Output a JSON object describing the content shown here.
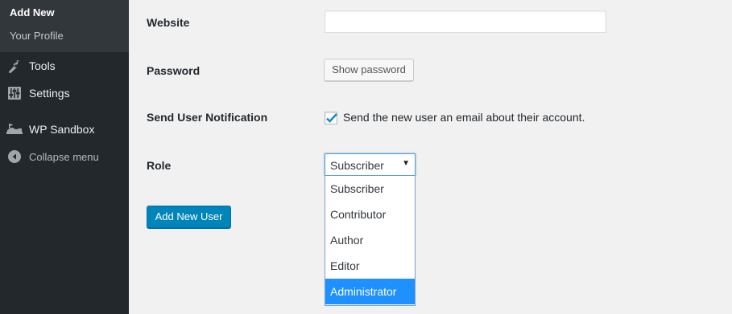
{
  "sidebar": {
    "submenu": [
      {
        "label": "Add New",
        "current": true
      },
      {
        "label": "Your Profile"
      }
    ],
    "menu": [
      {
        "label": "Tools",
        "icon": "wrench-icon"
      },
      {
        "label": "Settings",
        "icon": "sliders-icon"
      },
      {
        "label": "WP Sandbox",
        "icon": "sandbox-icon"
      },
      {
        "label": "Collapse menu",
        "icon": "collapse-arrow-icon"
      }
    ]
  },
  "form": {
    "website": {
      "label": "Website",
      "value": ""
    },
    "password": {
      "label": "Password",
      "button_label": "Show password"
    },
    "notification": {
      "label": "Send User Notification",
      "checkbox_label": "Send the new user an email about their account.",
      "checked": true
    },
    "role": {
      "label": "Role",
      "selected": "Subscriber",
      "options": [
        "Subscriber",
        "Contributor",
        "Author",
        "Editor",
        "Administrator"
      ],
      "highlighted": "Administrator"
    },
    "submit_label": "Add New User"
  },
  "colors": {
    "sidebar_bg": "#23282d",
    "submenu_bg": "#32373c",
    "primary_button": "#0085ba",
    "dropdown_highlight": "#1e90ff",
    "checkmark": "#1e8cbe"
  }
}
